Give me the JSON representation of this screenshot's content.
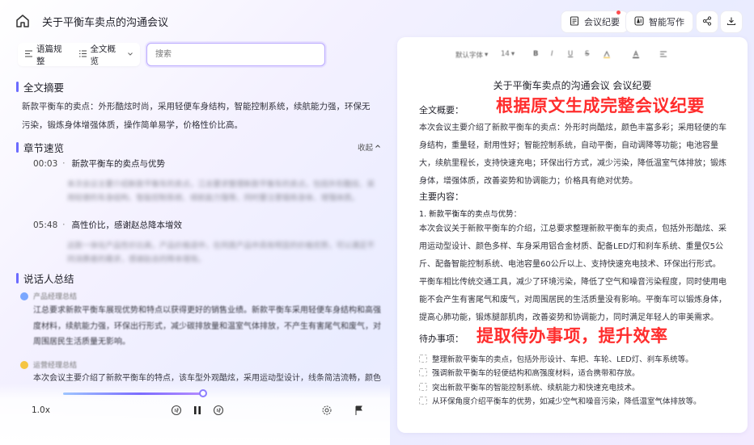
{
  "header": {
    "title": "关于平衡车卖点的沟通会议",
    "minutes_button": "会议纪要",
    "write_button": "智能写作",
    "icons": {
      "home": "home-icon",
      "minutes": "minutes-icon",
      "write": "ai-write-icon",
      "share": "share-icon",
      "download": "download-icon"
    }
  },
  "controls": {
    "view_mode": "语篇规整",
    "overview": "全文概览",
    "search_placeholder": "搜索"
  },
  "summary": {
    "heading": "全文摘要",
    "text": "新款平衡车的卖点：外形酷炫时尚，采用轻便车身结构，智能控制系统，续航能力强，环保无污染，锻炼身体增强体质，操作简单易学，价格性价比高。"
  },
  "chapters": {
    "heading": "章节速览",
    "collapse_label": "收起",
    "items": [
      {
        "time": "00:03",
        "title": "新款平衡车的卖点与优势",
        "summary": "本次会议主要介绍新款平衡车的卖点，江总要求整理新款平衡车的卖点，包括外形酷炫、采用轻便的车身结构、智能控制系统、续航能力强等，同时要注意锻炼身体、增强体质。"
      },
      {
        "time": "05:48",
        "title": "高性价比，感谢赵总降本增效",
        "summary": "这款一体化产品性价比高，产品价格适中，在同类产品中具有明显的价格优势，可以满足不同消费者的需求，感谢赵总的降本增效。"
      }
    ]
  },
  "speakers": {
    "heading": "说话人总结",
    "items": [
      {
        "name": "产品经理总结",
        "text": "江总要求新款平衡车展现优势和特点以获得更好的销售业绩。新款平衡车采用轻便车身结构和高强度材料，续航能力强，环保出行形式，减少碳排放量和温室气体排放，不产生有害尾气和废气，对周围居民生活质量无影响。",
        "avatar_color": "#7aa7ff"
      },
      {
        "name": "运营经理总结",
        "text": "本次会议主要介绍了新款平衡车的特点，该车型外观酷炫，采用运动型设计，线条简洁流畅，颜色多",
        "avatar_color": "#f5c542"
      }
    ]
  },
  "player": {
    "speed": "1.0x",
    "progress": 0.5,
    "icons": [
      "rewind-15-icon",
      "pause-icon",
      "forward-15-icon",
      "settings-icon",
      "flag-icon"
    ]
  },
  "editor": {
    "toolbar": {
      "font": "默认字体",
      "size": "14"
    },
    "title": "关于平衡车卖点的沟通会议 会议纪要",
    "overview_heading": "全文概要：",
    "overview_text": "本次会议主要介绍了新款平衡车的卖点：外形时尚酷炫，颜色丰富多彩；采用轻便的车身结构，重量轻，耐用性好；智能控制系统，自动平衡，自动调降等功能；电池容量大，续航里程长，支持快速充电；环保出行方式，减少污染，降低温室气体排放；锻炼身体，增强体质，改善姿势和协调能力；价格具有绝对优势。",
    "main_heading": "主要内容：",
    "point1_heading": "1. 新款平衡车的卖点与优势：",
    "point1_text": "本次会议关于新款平衡车的介绍，江总要求整理新款平衡车的卖点，包括外形酷炫、采用运动型设计、颜色多样、车身采用铝合金材质、配备LED灯和刹车系统、重量仅5公斤、配备智能控制系统、电池容量60公斤以上、支持快速充电技术、环保出行形式。平衡车相比传统交通工具，减少了环境污染，降低了空气和噪音污染程度，同时使用电能不会产生有害尾气和废气，对周围居民的生活质量没有影响。平衡车可以锻炼身体，提高心肺功能，锻炼腿部肌肉，改善姿势和协调能力，同时满足年轻人的审美需求。",
    "todo_heading": "待办事项：",
    "todos": [
      "整理新款平衡车的卖点，包括外形设计、车把、车轮、LED灯、刹车系统等。",
      "强调新款平衡车的轻便结构和高强度材料，适合携带和存放。",
      "突出新款平衡车的智能控制系统、续航能力和快速充电技术。",
      "从环保角度介绍平衡车的优势，如减少空气和噪音污染，降低温室气体排放等。"
    ]
  },
  "overlays": {
    "caption_top": "根据原文生成完整会议纪要",
    "caption_bottom": "提取待办事项，提升效率",
    "color": "#ff2d2d"
  }
}
